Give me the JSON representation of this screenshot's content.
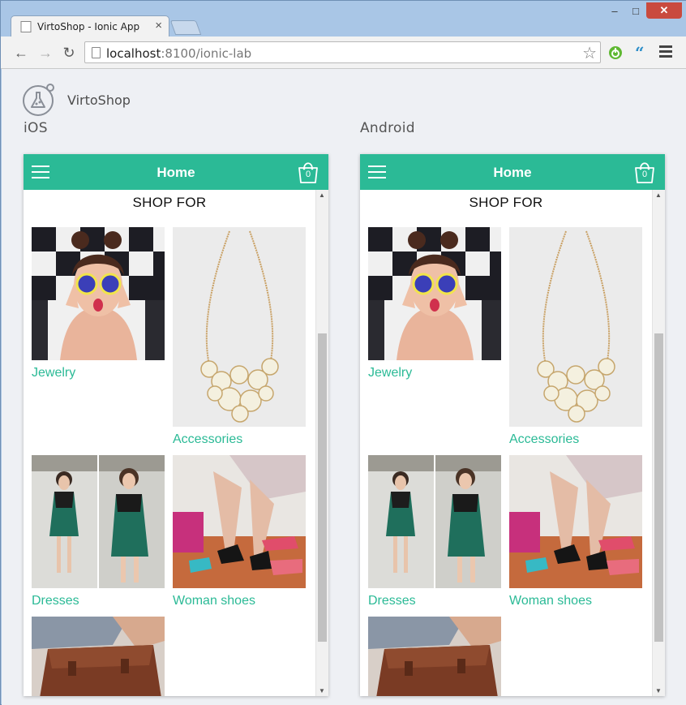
{
  "browser": {
    "tab_title": "VirtoShop - Ionic App",
    "url_host": "localhost",
    "url_rest": ":8100/ionic-lab"
  },
  "lab": {
    "title": "VirtoShop",
    "platforms": [
      "iOS",
      "Android"
    ]
  },
  "app": {
    "header_title": "Home",
    "cart_count": "0",
    "section_title": "SHOP FOR",
    "categories": [
      {
        "label": "Jewelry"
      },
      {
        "label": "Accessories"
      },
      {
        "label": "Dresses"
      },
      {
        "label": "Woman shoes"
      },
      {
        "label": ""
      }
    ]
  },
  "colors": {
    "accent": "#2bba96",
    "page_bg": "#eef0f4"
  }
}
